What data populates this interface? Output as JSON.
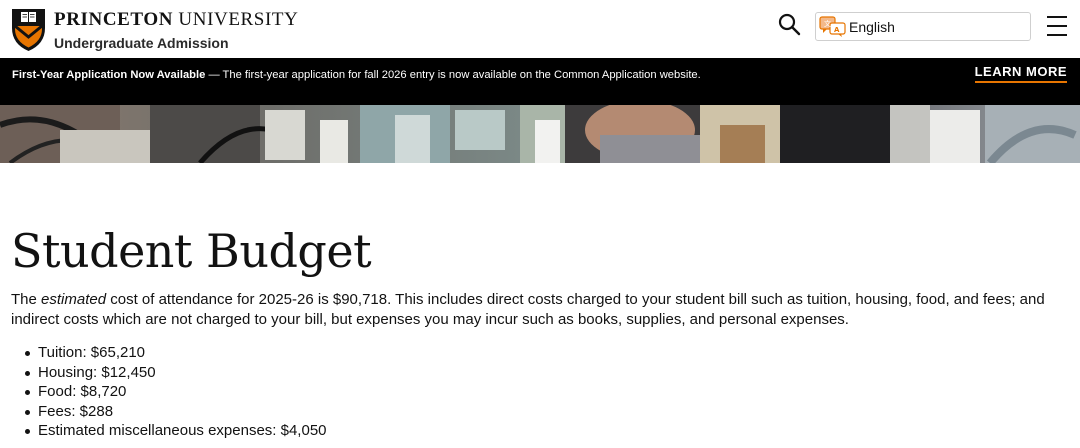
{
  "header": {
    "brand_bold": "PRINCETON",
    "brand_rest": " UNIVERSITY",
    "subbrand": "Undergraduate Admission",
    "language_selected": "English"
  },
  "alert": {
    "title": "First-Year Application Now Available",
    "separator": " — ",
    "body": "The first-year application for fall 2026 entry is now available on the Common Application website.",
    "cta": "LEARN MORE"
  },
  "main": {
    "title": "Student Budget",
    "intro_start": "The ",
    "intro_em": "estimated",
    "intro_rest": " cost of attendance for 2025-26 is $90,718. This includes direct costs charged to your student bill such as tuition, housing, food, and fees; and indirect costs which are not charged to your bill, but expenses you may incur such as books, supplies, and personal expenses.",
    "items": [
      "Tuition: $65,210",
      "Housing: $12,450",
      "Food: $8,720",
      "Fees: $288",
      "Estimated miscellaneous expenses: $4,050"
    ]
  },
  "colors": {
    "accent": "#e77500",
    "banner_bg": "#000000",
    "text": "#121212"
  },
  "icons": {
    "search": "search-icon",
    "language": "translate-icon",
    "menu": "hamburger-menu-icon",
    "logo": "princeton-shield-logo"
  }
}
